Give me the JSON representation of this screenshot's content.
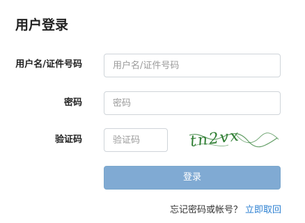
{
  "page": {
    "title": "用户登录"
  },
  "form": {
    "username": {
      "label": "用户名/证件号码",
      "value": "",
      "placeholder": "用户名/证件号码"
    },
    "password": {
      "label": "密码",
      "value": "",
      "placeholder": "密码"
    },
    "captcha": {
      "label": "验证码",
      "value": "",
      "placeholder": "验证码",
      "image_text": "tn2vx"
    },
    "submit_label": "登录"
  },
  "footer": {
    "forgot_text": "忘记密码或帐号？",
    "retrieve_link": "立即取回"
  },
  "colors": {
    "button_background": "#80aad3",
    "link": "#2b7fd1",
    "captcha_text": "#2e7d32"
  }
}
